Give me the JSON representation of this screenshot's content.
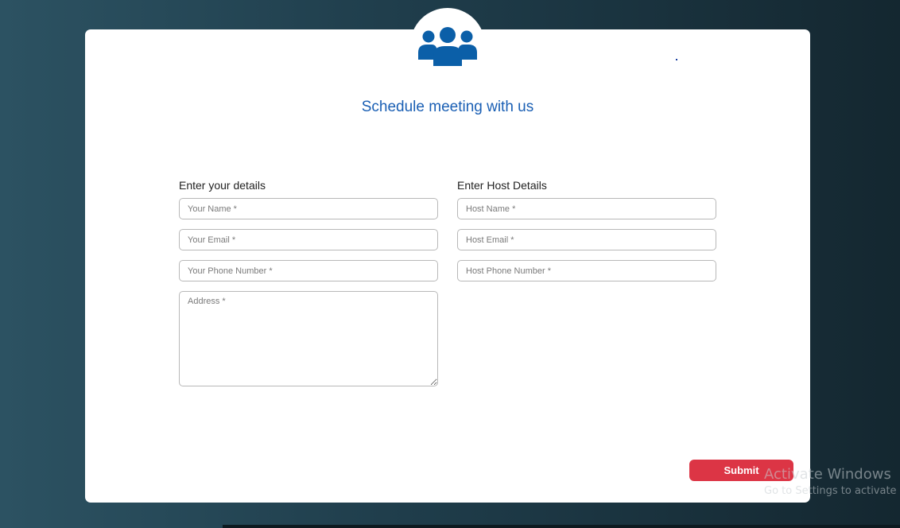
{
  "page": {
    "title": "Schedule meeting with us",
    "icon": "users-group-icon",
    "accent_color": "#1a5fb4",
    "icon_color": "#0b5fa8",
    "submit_color": "#dc3545"
  },
  "your_details": {
    "label": "Enter your details",
    "name_placeholder": "Your Name *",
    "email_placeholder": "Your Email *",
    "phone_placeholder": "Your Phone Number *",
    "address_placeholder": "Address *"
  },
  "host_details": {
    "label": "Enter Host Details",
    "name_placeholder": "Host Name *",
    "email_placeholder": "Host Email *",
    "phone_placeholder": "Host Phone Number *"
  },
  "actions": {
    "submit_label": "Submit"
  },
  "watermark": {
    "title": "Activate Windows",
    "subtitle": "Go to Settings to activate"
  }
}
